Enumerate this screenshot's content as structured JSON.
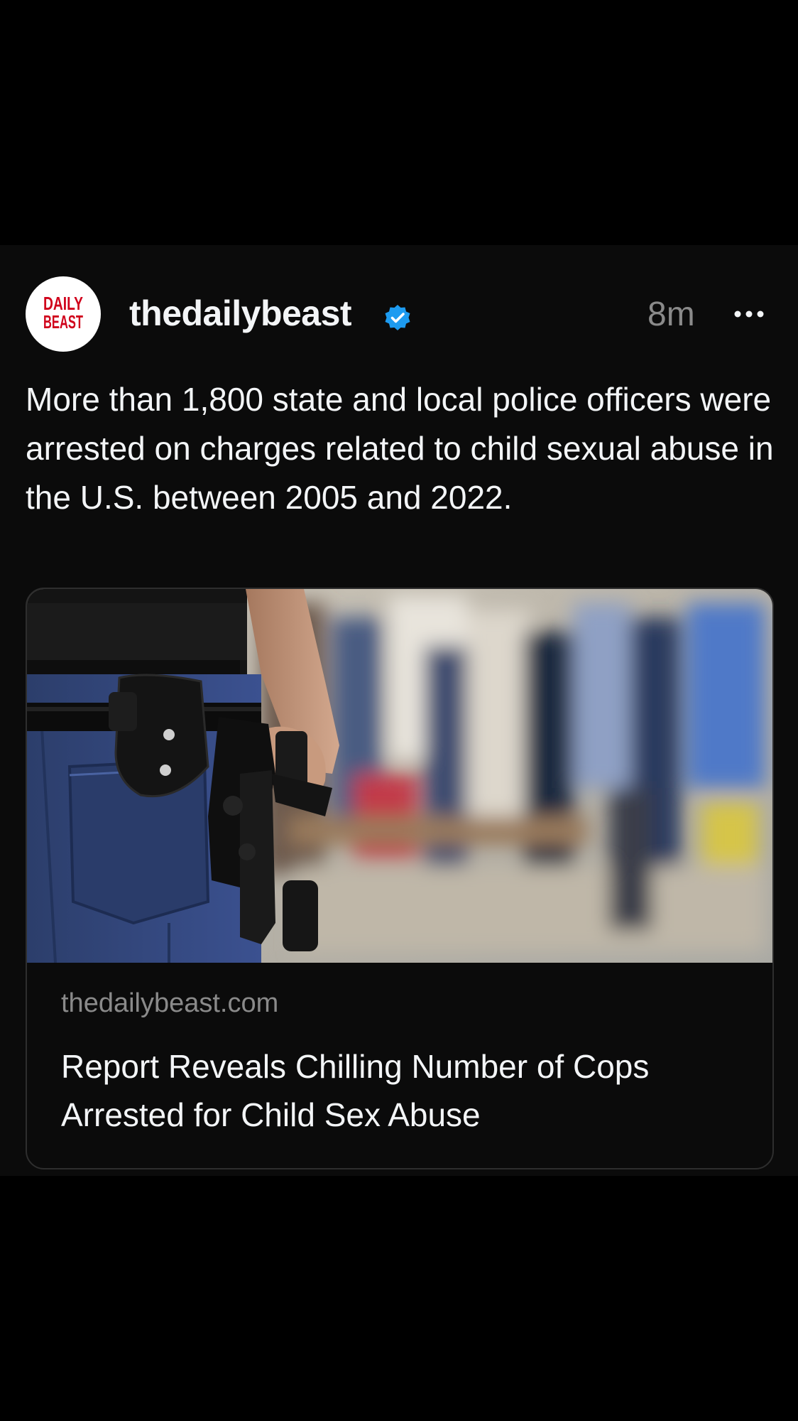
{
  "post": {
    "avatar_logo_lines": [
      "DAILY",
      "BEAST"
    ],
    "username": "thedailybeast",
    "verified_icon": "verified-badge-icon",
    "time_ago": "8m",
    "more_icon": "more-options-icon",
    "caption": "More than 1,800 state and local police officers were arrested on charges related to child sexual abuse in the U.S. between 2005 and 2022."
  },
  "link_card": {
    "image_description_icon": "article-thumbnail-image",
    "domain": "thedailybeast.com",
    "headline": "Report Reveals Chilling Number of Cops Arrested for Child Sex Abuse"
  },
  "colors": {
    "page_background": "#000000",
    "post_background": "#0b0b0b",
    "text_primary": "#f3f5f7",
    "text_secondary": "#8a8a8a",
    "verified_blue": "#1d9bf0",
    "brand_red": "#d0021b",
    "card_border": "#2e2e2e"
  }
}
